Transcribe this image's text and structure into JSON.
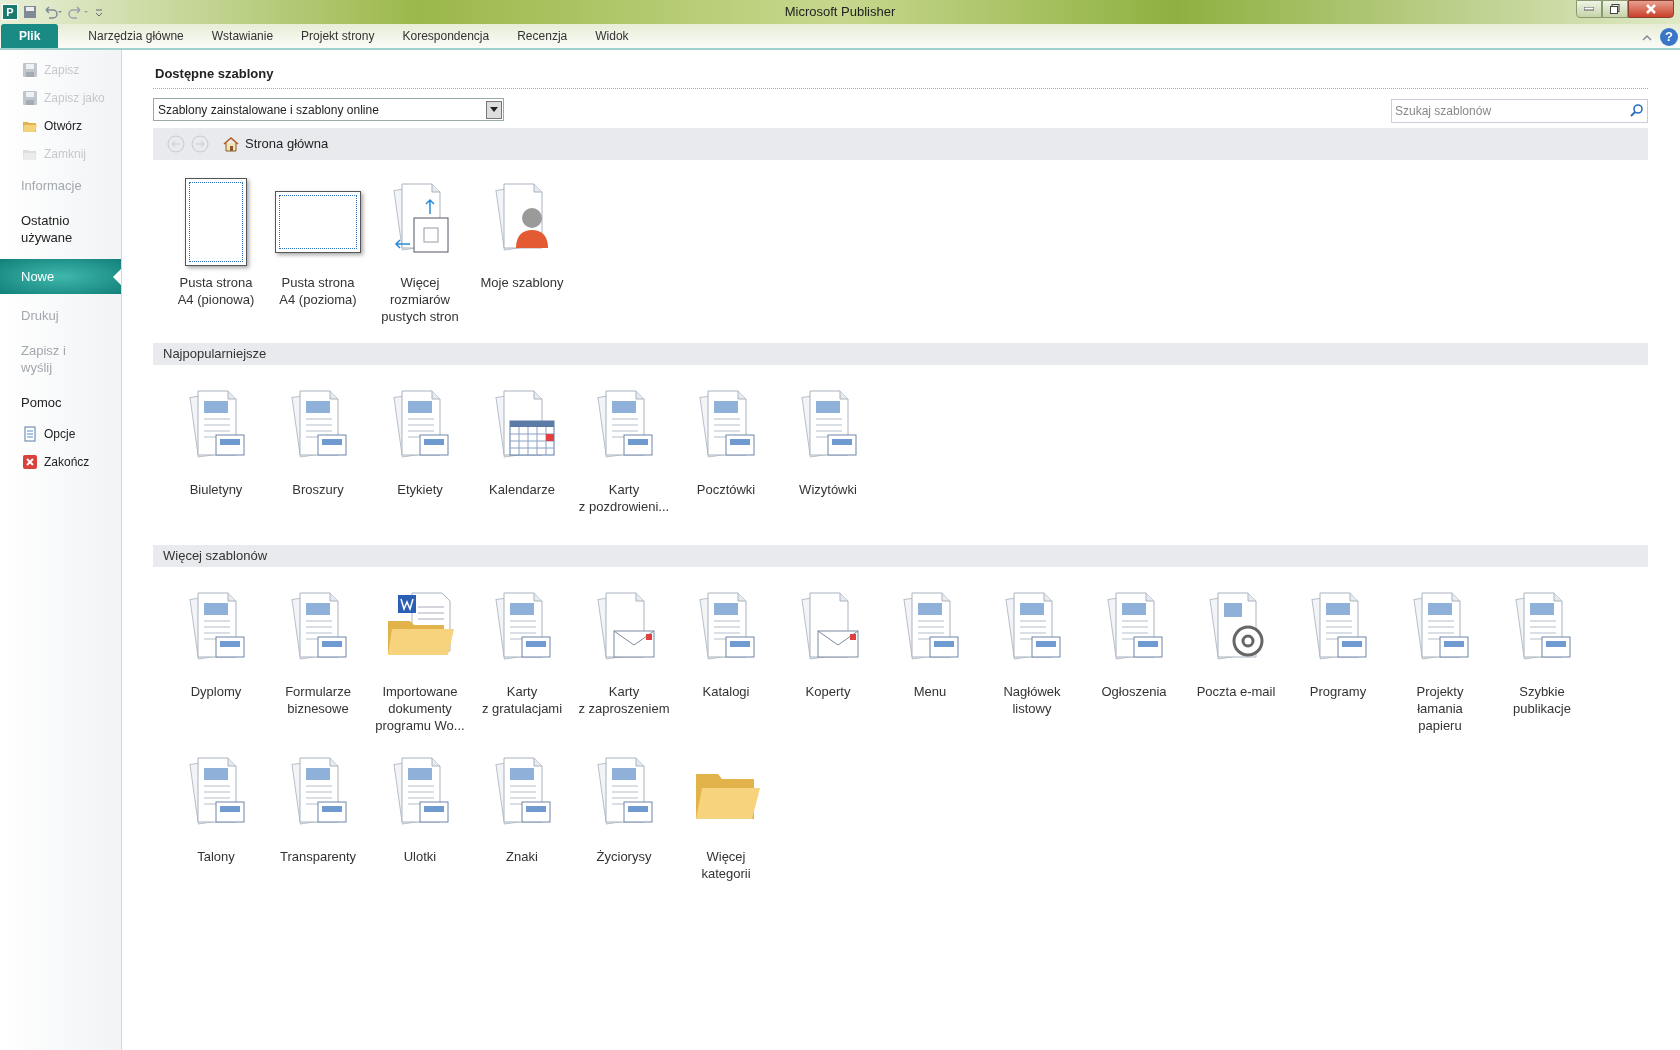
{
  "window": {
    "title": "Microsoft Publisher",
    "app_logo": "P",
    "help": "?"
  },
  "ribbon_tabs": [
    {
      "label": "Plik",
      "selected": true
    },
    {
      "label": "Narzędzia główne",
      "selected": false
    },
    {
      "label": "Wstawianie",
      "selected": false
    },
    {
      "label": "Projekt strony",
      "selected": false
    },
    {
      "label": "Korespondencja",
      "selected": false
    },
    {
      "label": "Recenzja",
      "selected": false
    },
    {
      "label": "Widok",
      "selected": false
    }
  ],
  "sidebar": {
    "items": [
      {
        "kind": "save",
        "label": "Zapisz",
        "disabled": true,
        "selected": false
      },
      {
        "kind": "saveas",
        "label": "Zapisz jako",
        "disabled": true,
        "selected": false
      },
      {
        "kind": "open",
        "label": "Otwórz",
        "disabled": false,
        "selected": false
      },
      {
        "kind": "close",
        "label": "Zamknij",
        "disabled": true,
        "selected": false
      },
      {
        "kind": "section",
        "label": "Informacje",
        "disabled": true,
        "selected": false
      },
      {
        "kind": "section",
        "label": "Ostatnio używane",
        "disabled": false,
        "selected": false
      },
      {
        "kind": "section",
        "label": "Nowe",
        "disabled": false,
        "selected": true
      },
      {
        "kind": "section",
        "label": "Drukuj",
        "disabled": true,
        "selected": false
      },
      {
        "kind": "section",
        "label": "Zapisz i wyślij",
        "disabled": true,
        "selected": false
      },
      {
        "kind": "section",
        "label": "Pomoc",
        "disabled": false,
        "selected": false
      },
      {
        "kind": "options",
        "label": "Opcje",
        "disabled": false,
        "selected": false
      },
      {
        "kind": "exit",
        "label": "Zakończ",
        "disabled": false,
        "selected": false
      }
    ]
  },
  "heading": "Dostępne szablony",
  "source_dropdown": {
    "value": "Szablony zainstalowane i szablony online"
  },
  "search": {
    "placeholder": "Szukaj szablonów"
  },
  "breadcrumb": "Strona główna",
  "sections": [
    {
      "items": [
        {
          "kind": "portrait",
          "lines": [
            "Pusta strona",
            "A4 (pionowa)"
          ]
        },
        {
          "kind": "landscape",
          "lines": [
            "Pusta strona",
            "A4 (pozioma)"
          ]
        },
        {
          "kind": "sizes",
          "lines": [
            "Więcej",
            "rozmiarów",
            "pustych stron"
          ]
        },
        {
          "kind": "user",
          "lines": [
            "Moje szablony"
          ]
        }
      ]
    },
    {
      "title": "Najpopularniejsze",
      "items": [
        {
          "kind": "template",
          "lines": [
            "Biuletyny"
          ]
        },
        {
          "kind": "template",
          "lines": [
            "Broszury"
          ]
        },
        {
          "kind": "template",
          "lines": [
            "Etykiety"
          ]
        },
        {
          "kind": "calendar",
          "lines": [
            "Kalendarze"
          ]
        },
        {
          "kind": "template",
          "lines": [
            "Karty",
            "z pozdrowieni..."
          ]
        },
        {
          "kind": "template",
          "lines": [
            "Pocztówki"
          ]
        },
        {
          "kind": "template",
          "lines": [
            "Wizytówki"
          ]
        }
      ]
    },
    {
      "title": "Więcej szablonów",
      "items": [
        {
          "kind": "template",
          "lines": [
            "Dyplomy"
          ]
        },
        {
          "kind": "template",
          "lines": [
            "Formularze",
            "biznesowe"
          ]
        },
        {
          "kind": "folder-doc",
          "lines": [
            "Importowane",
            "dokumenty",
            "programu Wo..."
          ]
        },
        {
          "kind": "template",
          "lines": [
            "Karty",
            "z gratulacjami"
          ]
        },
        {
          "kind": "envelope",
          "lines": [
            "Karty",
            "z zaproszeniem"
          ]
        },
        {
          "kind": "template",
          "lines": [
            "Katalogi"
          ]
        },
        {
          "kind": "envelope",
          "lines": [
            "Koperty"
          ]
        },
        {
          "kind": "template",
          "lines": [
            "Menu"
          ]
        },
        {
          "kind": "template",
          "lines": [
            "Nagłówek",
            "listowy"
          ]
        },
        {
          "kind": "template",
          "lines": [
            "Ogłoszenia"
          ]
        },
        {
          "kind": "email",
          "lines": [
            "Poczta e-mail"
          ]
        },
        {
          "kind": "template",
          "lines": [
            "Programy"
          ]
        },
        {
          "kind": "template",
          "lines": [
            "Projekty",
            "łamania",
            "papieru"
          ]
        },
        {
          "kind": "template",
          "lines": [
            "Szybkie",
            "publikacje"
          ]
        },
        {
          "kind": "template",
          "lines": [
            "Talony"
          ]
        },
        {
          "kind": "template",
          "lines": [
            "Transparenty"
          ]
        },
        {
          "kind": "template",
          "lines": [
            "Ulotki"
          ]
        },
        {
          "kind": "template",
          "lines": [
            "Znaki"
          ]
        },
        {
          "kind": "template",
          "lines": [
            "Życiorysy"
          ]
        },
        {
          "kind": "folder",
          "lines": [
            "Więcej",
            "kategorii"
          ]
        }
      ]
    }
  ]
}
